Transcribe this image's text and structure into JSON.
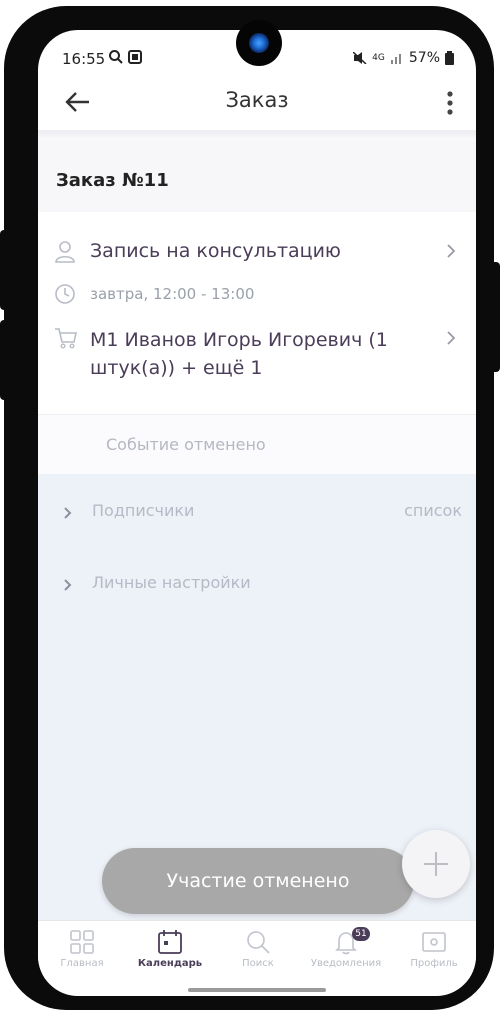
{
  "status_bar": {
    "time": "16:55",
    "network": "4G",
    "battery": "57%"
  },
  "app_bar": {
    "title": "Заказ"
  },
  "order": {
    "heading": "Заказ №11",
    "service": "Запись на консультацию",
    "datetime": "завтра, 12:00 - 13:00",
    "items": "М1 Иванов Игорь Игоревич (1 штук(а)) + ещё 1",
    "status": "Событие отменено"
  },
  "sections": [
    {
      "label": "Подписчики",
      "extra": "список"
    },
    {
      "label": "Личные настройки",
      "extra": ""
    }
  ],
  "toast": "Участие отменено",
  "bottom_nav": [
    {
      "label": "Главная",
      "icon": "grid-icon"
    },
    {
      "label": "Календарь",
      "icon": "calendar-icon",
      "active": true
    },
    {
      "label": "Поиск",
      "icon": "search-icon"
    },
    {
      "label": "Уведомления",
      "icon": "bell-icon",
      "badge": "51"
    },
    {
      "label": "Профиль",
      "icon": "profile-icon"
    }
  ],
  "colors": {
    "accent": "#4a3d58",
    "muted_text": "#b4bac6",
    "lower_background": "#edf1f8",
    "toast": "#a8a8a8"
  }
}
